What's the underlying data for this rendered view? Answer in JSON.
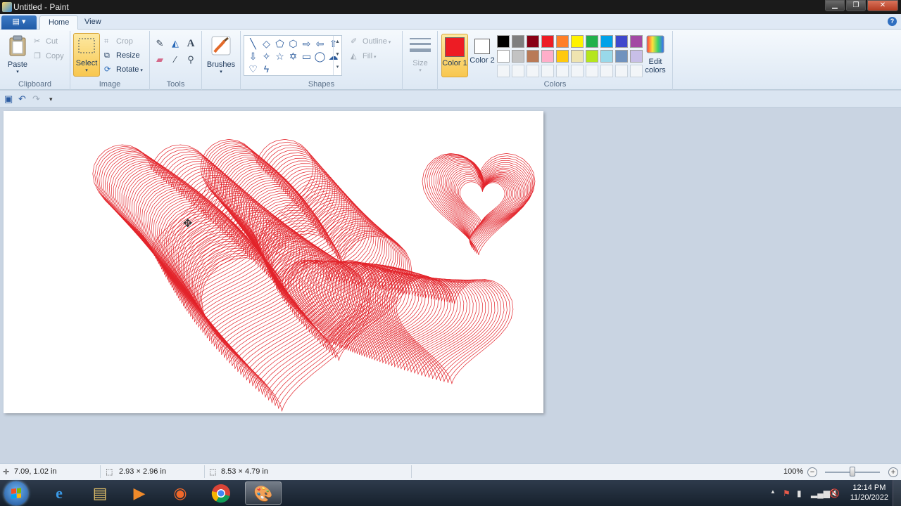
{
  "window": {
    "title": "Untitled - Paint",
    "buttons": {
      "minimize": "▁",
      "maximize": "❐",
      "close": "✕"
    }
  },
  "ribbon_tabs": {
    "home": "Home",
    "view": "View",
    "app_menu": "▤ ▾",
    "help": "?"
  },
  "clipboard": {
    "group_label": "Clipboard",
    "paste": "Paste",
    "cut": "Cut",
    "copy": "Copy"
  },
  "image": {
    "group_label": "Image",
    "select": "Select",
    "crop": "Crop",
    "resize": "Resize",
    "rotate": "Rotate"
  },
  "tools": {
    "group_label": "Tools"
  },
  "brushes": {
    "label": "Brushes"
  },
  "shapes": {
    "group_label": "Shapes",
    "outline": "Outline",
    "fill": "Fill"
  },
  "size": {
    "label": "Size"
  },
  "colors": {
    "group_label": "Colors",
    "color1_label": "Color 1",
    "color2_label": "Color 2",
    "color1_value": "#ed1c24",
    "color2_value": "#ffffff",
    "edit_colors": "Edit colors",
    "palette_row1": [
      "#000000",
      "#7f7f7f",
      "#880015",
      "#ed1c24",
      "#ff7f27",
      "#fff200",
      "#22b14c",
      "#00a2e8",
      "#3f48cc",
      "#a349a4"
    ],
    "palette_row2": [
      "#ffffff",
      "#c3c3c3",
      "#b97a57",
      "#ffaec9",
      "#ffc90e",
      "#efe4b0",
      "#b5e61d",
      "#99d9ea",
      "#7092be",
      "#c8bfe7"
    ]
  },
  "canvas": {
    "stroke_color": "#e3242b"
  },
  "status": {
    "cursor_pos": "7.09, 1.02 in",
    "selection_size": "2.93 × 2.96 in",
    "image_size": "8.53 × 4.79 in",
    "zoom": "100%"
  },
  "taskbar": {
    "clock_time": "12:14 PM",
    "clock_date": "11/20/2022"
  }
}
